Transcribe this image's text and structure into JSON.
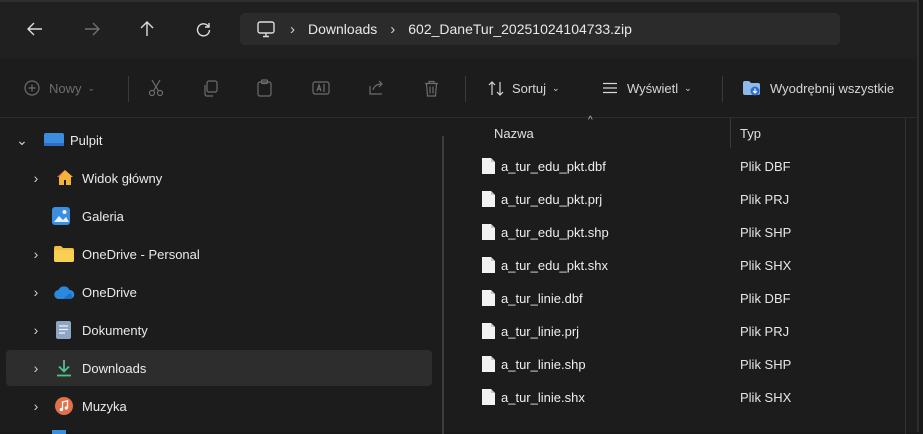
{
  "address_bar": {
    "back_icon": "arrow-left-icon",
    "forward_icon": "arrow-right-icon",
    "up_icon": "arrow-up-icon",
    "refresh_icon": "refresh-icon",
    "breadcrumbs": [
      "Downloads",
      "602_DaneTur_20251024104733.zip"
    ]
  },
  "command_bar": {
    "new_label": "Nowy",
    "sort_label": "Sortuj",
    "view_label": "Wyświetl",
    "extract_label": "Wyodrębnij wszystkie"
  },
  "nav_pane": {
    "items": [
      {
        "label": "Pulpit",
        "icon": "desktop-icon",
        "expanded": true
      },
      {
        "label": "Widok główny",
        "icon": "home-icon"
      },
      {
        "label": "Galeria",
        "icon": "gallery-icon"
      },
      {
        "label": "OneDrive - Personal",
        "icon": "folder-icon"
      },
      {
        "label": "OneDrive",
        "icon": "cloud-icon"
      },
      {
        "label": "Dokumenty",
        "icon": "documents-icon"
      },
      {
        "label": "Downloads",
        "icon": "download-icon",
        "selected": true
      },
      {
        "label": "Muzyka",
        "icon": "music-icon"
      }
    ]
  },
  "file_list": {
    "columns": {
      "name": "Nazwa",
      "type": "Typ"
    },
    "files": [
      {
        "name": "a_tur_edu_pkt.dbf",
        "type": "Plik DBF"
      },
      {
        "name": "a_tur_edu_pkt.prj",
        "type": "Plik PRJ"
      },
      {
        "name": "a_tur_edu_pkt.shp",
        "type": "Plik SHP"
      },
      {
        "name": "a_tur_edu_pkt.shx",
        "type": "Plik SHX"
      },
      {
        "name": "a_tur_linie.dbf",
        "type": "Plik DBF"
      },
      {
        "name": "a_tur_linie.prj",
        "type": "Plik PRJ"
      },
      {
        "name": "a_tur_linie.shp",
        "type": "Plik SHP"
      },
      {
        "name": "a_tur_linie.shx",
        "type": "Plik SHX"
      }
    ]
  },
  "colors": {
    "background": "#1c1c1c",
    "selected_row": "#2d2d2d",
    "folder_yellow": "#f2c03a",
    "download_green": "#4fc08d",
    "onedrive_blue": "#2a8ae0"
  }
}
